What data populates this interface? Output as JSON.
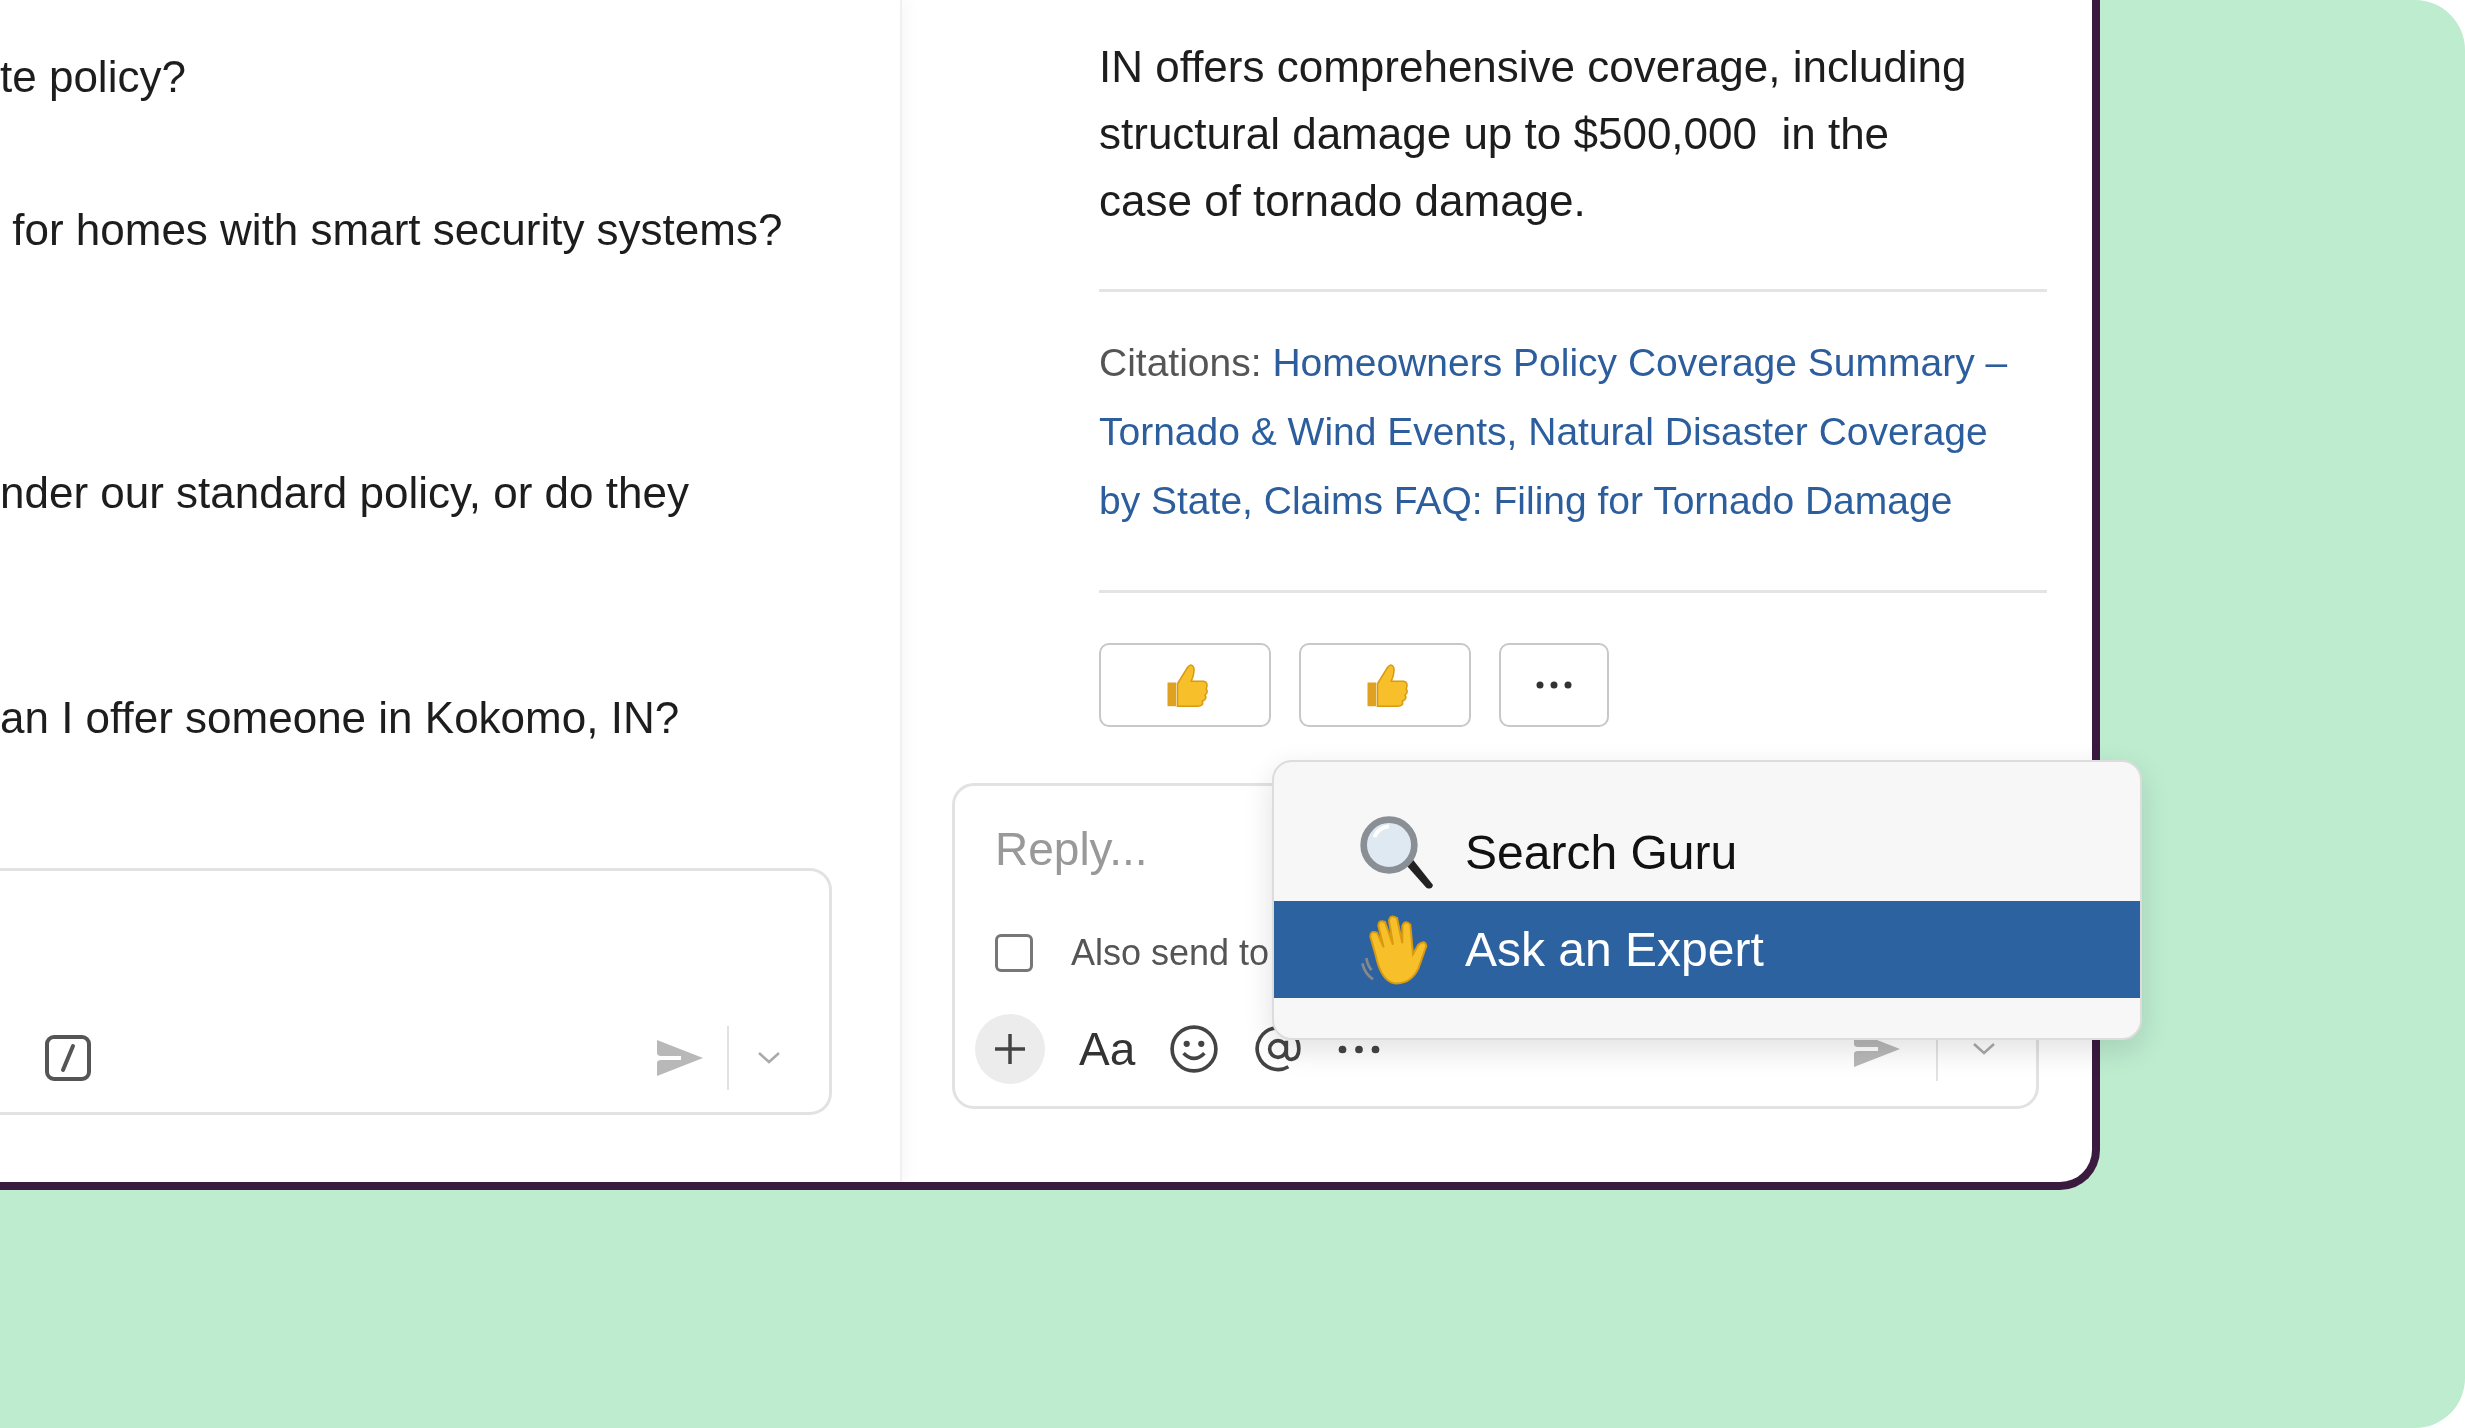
{
  "left_pane": {
    "messages": [
      {
        "text": "te policy?"
      },
      {
        "text": " for homes with smart security systems?"
      },
      {
        "text": "nder our standard policy, or do they"
      },
      {
        "text": "an I offer someone in Kokomo, IN?"
      }
    ]
  },
  "answer": {
    "text": "IN offers comprehensive coverage, including\nstructural damage up to $500,000  in the\ncase of tornado damage."
  },
  "citations": {
    "label": "Citations:",
    "links": [
      {
        "text": "Homeowners Policy Coverage Summary – Tornado & Wind Events,"
      },
      {
        "text": "Natural Disaster Coverage by State,"
      },
      {
        "text": "Claims FAQ: Filing for Tornado Damage"
      }
    ]
  },
  "reactions": [
    {
      "kind": "thumbs-up"
    },
    {
      "kind": "thumbs-up"
    },
    {
      "kind": "more"
    }
  ],
  "reply": {
    "placeholder": "Reply...",
    "also_send": {
      "label": "Also send to",
      "checked": false
    },
    "format_label": "Aa"
  },
  "menu": {
    "items": [
      {
        "kind": "magnifier",
        "label": "Search Guru",
        "selected": false
      },
      {
        "kind": "wave",
        "label": "Ask an Expert",
        "selected": true
      }
    ]
  }
}
